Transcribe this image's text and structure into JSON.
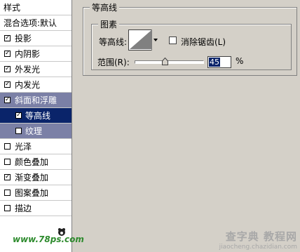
{
  "sidebar": {
    "header": "样式",
    "blend": "混合选项:默认",
    "items": [
      {
        "label": "投影",
        "checked": true
      },
      {
        "label": "内阴影",
        "checked": true
      },
      {
        "label": "外发光",
        "checked": true
      },
      {
        "label": "内发光",
        "checked": true
      },
      {
        "label": "斜面和浮雕",
        "checked": true
      },
      {
        "label": "等高线",
        "checked": true
      },
      {
        "label": "纹理",
        "checked": false
      },
      {
        "label": "光泽",
        "checked": false
      },
      {
        "label": "颜色叠加",
        "checked": false
      },
      {
        "label": "渐变叠加",
        "checked": true
      },
      {
        "label": "图案叠加",
        "checked": false
      },
      {
        "label": "描边",
        "checked": false
      }
    ],
    "watermark": "www.78ps.com"
  },
  "panel": {
    "group_title": "等高线",
    "subgroup_title": "图素",
    "contour_label": "等高线:",
    "antialias_label": "消除锯齿(L)",
    "range_label": "范围(R):",
    "range_value": "45",
    "range_unit": "%",
    "range_fraction": 0.45
  },
  "watermark": {
    "title": "查字典 教程网",
    "url": "jiaocheng.chazidian.com"
  },
  "colors": {
    "selected": "#0a246a",
    "active": "#7b80a6",
    "dialog_bg": "#d4d0c8"
  }
}
